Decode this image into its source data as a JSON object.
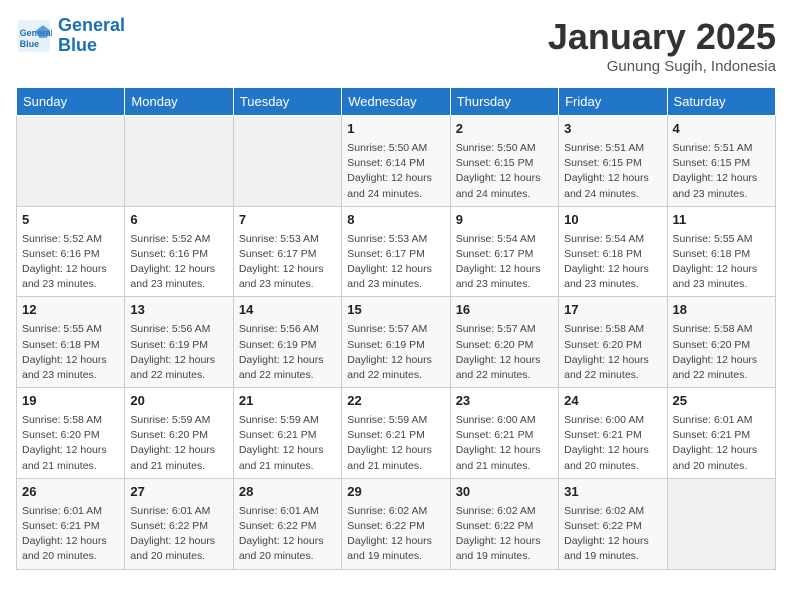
{
  "header": {
    "logo_line1": "General",
    "logo_line2": "Blue",
    "title": "January 2025",
    "subtitle": "Gunung Sugih, Indonesia"
  },
  "columns": [
    "Sunday",
    "Monday",
    "Tuesday",
    "Wednesday",
    "Thursday",
    "Friday",
    "Saturday"
  ],
  "weeks": [
    [
      {
        "day": "",
        "info": ""
      },
      {
        "day": "",
        "info": ""
      },
      {
        "day": "",
        "info": ""
      },
      {
        "day": "1",
        "info": "Sunrise: 5:50 AM\nSunset: 6:14 PM\nDaylight: 12 hours\nand 24 minutes."
      },
      {
        "day": "2",
        "info": "Sunrise: 5:50 AM\nSunset: 6:15 PM\nDaylight: 12 hours\nand 24 minutes."
      },
      {
        "day": "3",
        "info": "Sunrise: 5:51 AM\nSunset: 6:15 PM\nDaylight: 12 hours\nand 24 minutes."
      },
      {
        "day": "4",
        "info": "Sunrise: 5:51 AM\nSunset: 6:15 PM\nDaylight: 12 hours\nand 23 minutes."
      }
    ],
    [
      {
        "day": "5",
        "info": "Sunrise: 5:52 AM\nSunset: 6:16 PM\nDaylight: 12 hours\nand 23 minutes."
      },
      {
        "day": "6",
        "info": "Sunrise: 5:52 AM\nSunset: 6:16 PM\nDaylight: 12 hours\nand 23 minutes."
      },
      {
        "day": "7",
        "info": "Sunrise: 5:53 AM\nSunset: 6:17 PM\nDaylight: 12 hours\nand 23 minutes."
      },
      {
        "day": "8",
        "info": "Sunrise: 5:53 AM\nSunset: 6:17 PM\nDaylight: 12 hours\nand 23 minutes."
      },
      {
        "day": "9",
        "info": "Sunrise: 5:54 AM\nSunset: 6:17 PM\nDaylight: 12 hours\nand 23 minutes."
      },
      {
        "day": "10",
        "info": "Sunrise: 5:54 AM\nSunset: 6:18 PM\nDaylight: 12 hours\nand 23 minutes."
      },
      {
        "day": "11",
        "info": "Sunrise: 5:55 AM\nSunset: 6:18 PM\nDaylight: 12 hours\nand 23 minutes."
      }
    ],
    [
      {
        "day": "12",
        "info": "Sunrise: 5:55 AM\nSunset: 6:18 PM\nDaylight: 12 hours\nand 23 minutes."
      },
      {
        "day": "13",
        "info": "Sunrise: 5:56 AM\nSunset: 6:19 PM\nDaylight: 12 hours\nand 22 minutes."
      },
      {
        "day": "14",
        "info": "Sunrise: 5:56 AM\nSunset: 6:19 PM\nDaylight: 12 hours\nand 22 minutes."
      },
      {
        "day": "15",
        "info": "Sunrise: 5:57 AM\nSunset: 6:19 PM\nDaylight: 12 hours\nand 22 minutes."
      },
      {
        "day": "16",
        "info": "Sunrise: 5:57 AM\nSunset: 6:20 PM\nDaylight: 12 hours\nand 22 minutes."
      },
      {
        "day": "17",
        "info": "Sunrise: 5:58 AM\nSunset: 6:20 PM\nDaylight: 12 hours\nand 22 minutes."
      },
      {
        "day": "18",
        "info": "Sunrise: 5:58 AM\nSunset: 6:20 PM\nDaylight: 12 hours\nand 22 minutes."
      }
    ],
    [
      {
        "day": "19",
        "info": "Sunrise: 5:58 AM\nSunset: 6:20 PM\nDaylight: 12 hours\nand 21 minutes."
      },
      {
        "day": "20",
        "info": "Sunrise: 5:59 AM\nSunset: 6:20 PM\nDaylight: 12 hours\nand 21 minutes."
      },
      {
        "day": "21",
        "info": "Sunrise: 5:59 AM\nSunset: 6:21 PM\nDaylight: 12 hours\nand 21 minutes."
      },
      {
        "day": "22",
        "info": "Sunrise: 5:59 AM\nSunset: 6:21 PM\nDaylight: 12 hours\nand 21 minutes."
      },
      {
        "day": "23",
        "info": "Sunrise: 6:00 AM\nSunset: 6:21 PM\nDaylight: 12 hours\nand 21 minutes."
      },
      {
        "day": "24",
        "info": "Sunrise: 6:00 AM\nSunset: 6:21 PM\nDaylight: 12 hours\nand 20 minutes."
      },
      {
        "day": "25",
        "info": "Sunrise: 6:01 AM\nSunset: 6:21 PM\nDaylight: 12 hours\nand 20 minutes."
      }
    ],
    [
      {
        "day": "26",
        "info": "Sunrise: 6:01 AM\nSunset: 6:21 PM\nDaylight: 12 hours\nand 20 minutes."
      },
      {
        "day": "27",
        "info": "Sunrise: 6:01 AM\nSunset: 6:22 PM\nDaylight: 12 hours\nand 20 minutes."
      },
      {
        "day": "28",
        "info": "Sunrise: 6:01 AM\nSunset: 6:22 PM\nDaylight: 12 hours\nand 20 minutes."
      },
      {
        "day": "29",
        "info": "Sunrise: 6:02 AM\nSunset: 6:22 PM\nDaylight: 12 hours\nand 19 minutes."
      },
      {
        "day": "30",
        "info": "Sunrise: 6:02 AM\nSunset: 6:22 PM\nDaylight: 12 hours\nand 19 minutes."
      },
      {
        "day": "31",
        "info": "Sunrise: 6:02 AM\nSunset: 6:22 PM\nDaylight: 12 hours\nand 19 minutes."
      },
      {
        "day": "",
        "info": ""
      }
    ]
  ]
}
